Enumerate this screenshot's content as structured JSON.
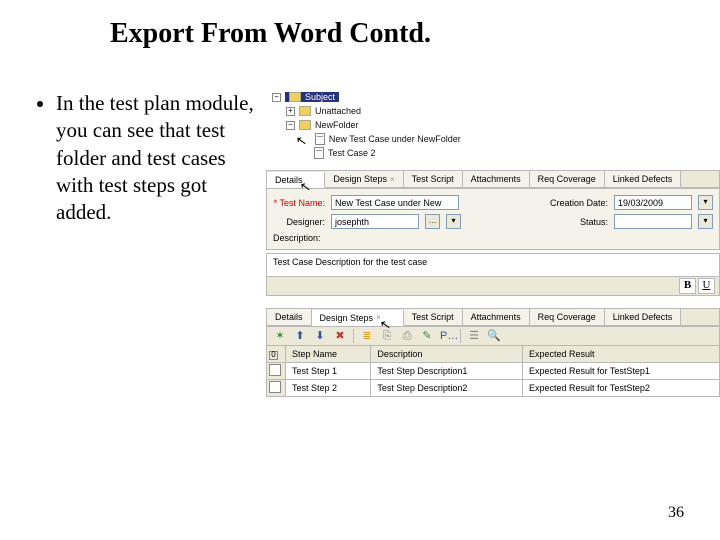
{
  "title": "Export From Word Contd.",
  "bullet": "In the test plan module, you can see that test folder and test cases with test steps got added.",
  "page_number": "36",
  "tree": {
    "root": "Subject",
    "unattached": "Unattached",
    "new_folder": "NewFolder",
    "case1": "New Test Case under NewFolder",
    "case2": "Test Case 2"
  },
  "tabs_upper": {
    "details": "Details",
    "design_steps": "Design Steps",
    "test_script": "Test Script",
    "attachments": "Attachments",
    "req_coverage": "Req Coverage",
    "linked_defects": "Linked Defects"
  },
  "form": {
    "test_name_label": "* Test Name:",
    "test_name_value": "New Test Case under New",
    "creation_date_label": "Creation Date:",
    "creation_date_value": "19/03/2009",
    "designer_label": "Designer:",
    "designer_value": "josephth",
    "status_label": "Status:",
    "status_value": "",
    "desc_label": "Description:",
    "desc_value": "Test Case Description for the test case"
  },
  "rich_text": {
    "bold": "B",
    "underline": "U"
  },
  "toolbar_icons": {
    "add": "✶",
    "up": "⬆",
    "down": "⬇",
    "delete": "✖",
    "renumber": "≣",
    "copy": "⎘",
    "paste": "⎙",
    "edit": "✎",
    "params": "P…",
    "select": "☰",
    "find": "🔍"
  },
  "steps": {
    "headers": {
      "idx": "",
      "name": "Step Name",
      "desc": "Description",
      "exp": "Expected Result"
    },
    "rows": [
      {
        "name": "Test Step 1",
        "desc": "Test Step Description1",
        "exp": "Expected Result for TestStep1"
      },
      {
        "name": "Test Step 2",
        "desc": "Test Step Description2",
        "exp": "Expected Result for TestStep2"
      }
    ]
  }
}
